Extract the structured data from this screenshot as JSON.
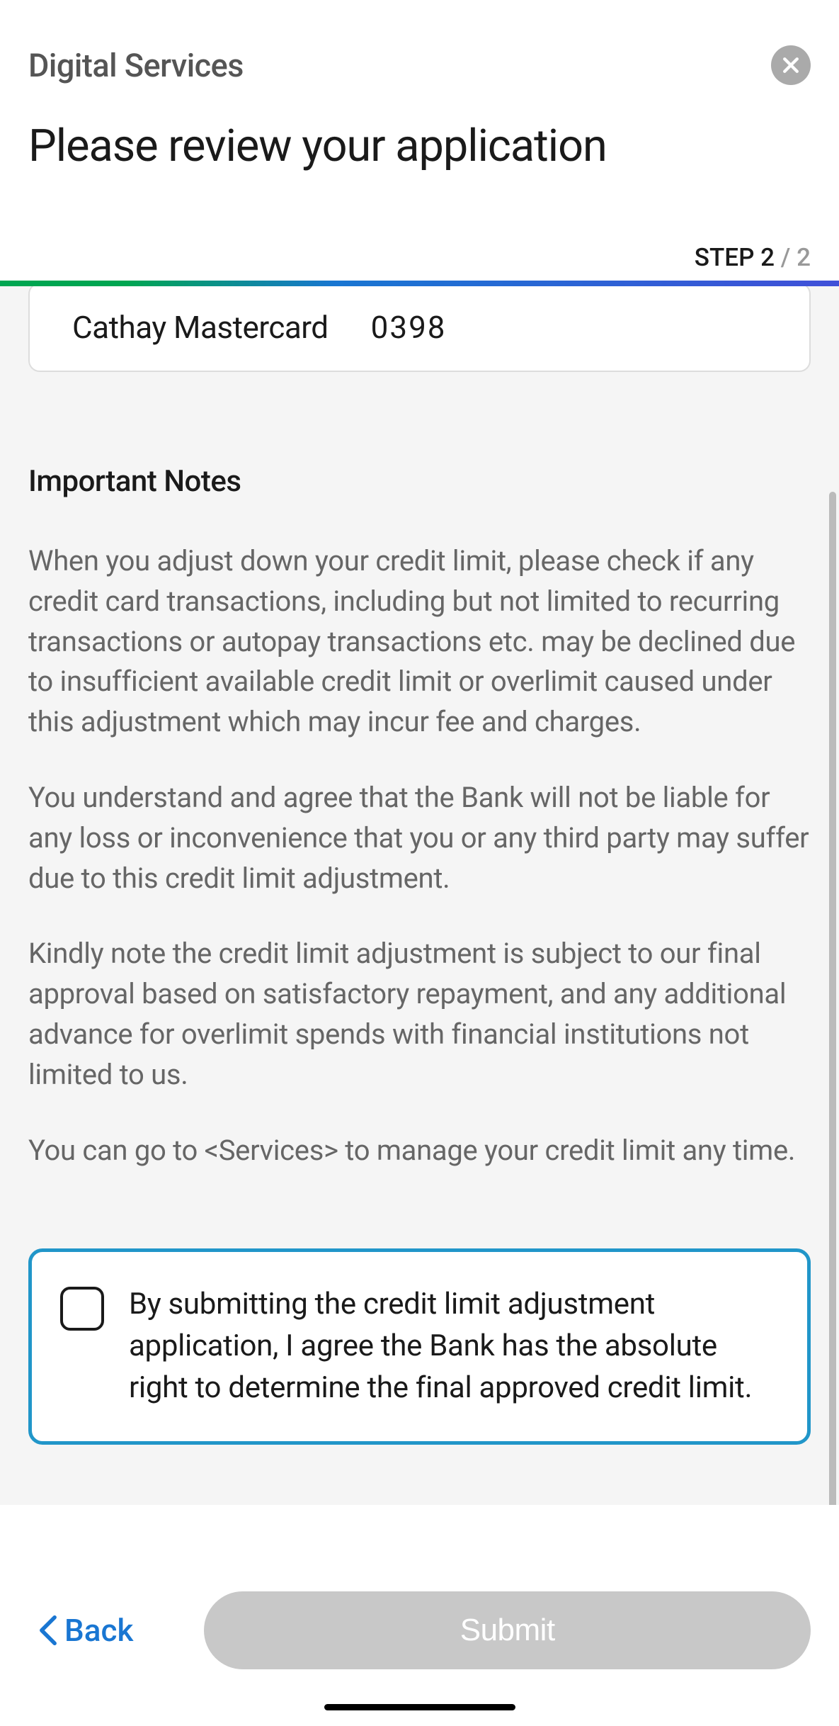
{
  "header": {
    "service_label": "Digital Services",
    "page_title": "Please review your application"
  },
  "step": {
    "label": "STEP",
    "current": "2",
    "separator": " / ",
    "total": "2"
  },
  "card": {
    "name": "Cathay Mastercard",
    "digits": "0398"
  },
  "notes": {
    "heading": "Important Notes",
    "p1": "When you adjust down your credit limit, please check if any credit card transactions, including but not limited to recurring transactions or autopay transactions etc. may be declined due to insufficient available credit limit or overlimit caused under this adjustment which may incur fee and charges.",
    "p2": "You understand and agree that the Bank will not be liable for any loss or inconvenience that you or any third party may suffer due to this credit limit adjustment.",
    "p3": "Kindly note the credit limit adjustment is subject to our final approval based on satisfactory repayment, and any additional advance for overlimit spends with financial institutions not limited to us.",
    "p4": "You can go to <Services> to manage your credit limit any time."
  },
  "agreement": {
    "text": "By submitting the credit limit adjustment application, I agree the Bank has the absolute right to determine the final approved credit limit."
  },
  "footer": {
    "back_label": "Back",
    "submit_label": "Submit"
  }
}
